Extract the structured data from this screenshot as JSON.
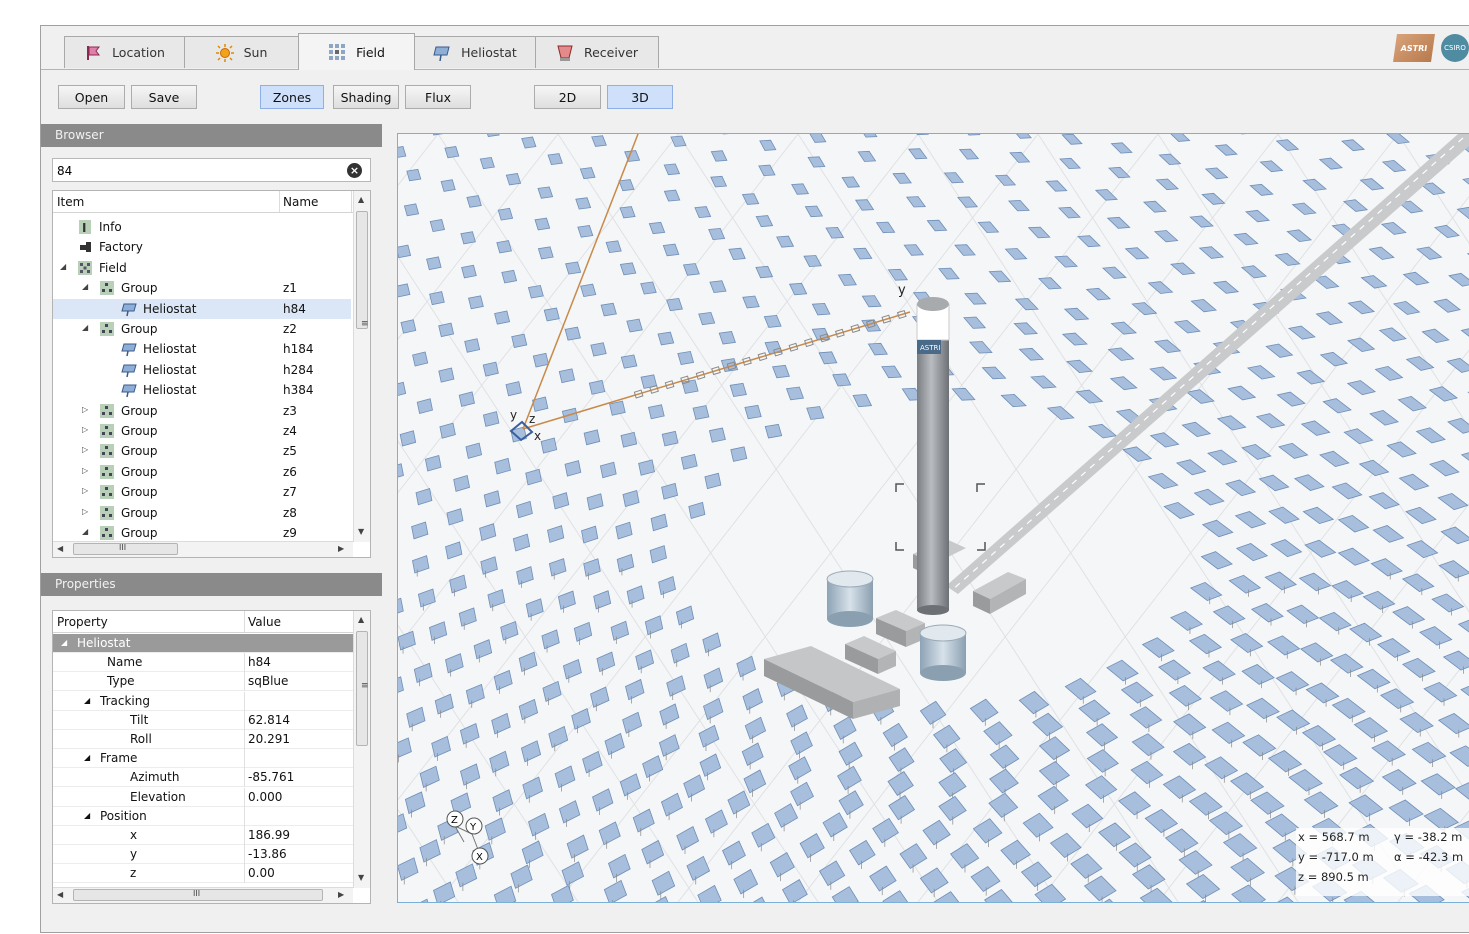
{
  "tabs": [
    {
      "label": "Location",
      "icon": "flag-icon"
    },
    {
      "label": "Sun",
      "icon": "sun-icon"
    },
    {
      "label": "Field",
      "icon": "field-grid-icon",
      "active": true
    },
    {
      "label": "Heliostat",
      "icon": "heliostat-icon"
    },
    {
      "label": "Receiver",
      "icon": "receiver-icon"
    }
  ],
  "logos": {
    "astri": "ASTRI",
    "csiro": "CSIRO"
  },
  "toolbar": {
    "open": "Open",
    "save": "Save",
    "zones": "Zones",
    "shading": "Shading",
    "flux": "Flux",
    "view2d": "2D",
    "view3d": "3D"
  },
  "browser": {
    "title": "Browser",
    "search_value": "84",
    "col_item": "Item",
    "col_name": "Name",
    "rows": [
      {
        "label": "Info",
        "name": "",
        "icon": "info-icon"
      },
      {
        "label": "Factory",
        "name": "",
        "icon": "factory-icon"
      },
      {
        "label": "Field",
        "name": "",
        "icon": "field-icon"
      },
      {
        "label": "Group",
        "name": "z1",
        "icon": "group-icon"
      },
      {
        "label": "Heliostat",
        "name": "h84",
        "icon": "heliostat-icon",
        "selected": true
      },
      {
        "label": "Group",
        "name": "z2",
        "icon": "group-icon"
      },
      {
        "label": "Heliostat",
        "name": "h184",
        "icon": "heliostat-icon"
      },
      {
        "label": "Heliostat",
        "name": "h284",
        "icon": "heliostat-icon"
      },
      {
        "label": "Heliostat",
        "name": "h384",
        "icon": "heliostat-icon"
      },
      {
        "label": "Group",
        "name": "z3",
        "icon": "group-icon"
      },
      {
        "label": "Group",
        "name": "z4",
        "icon": "group-icon"
      },
      {
        "label": "Group",
        "name": "z5",
        "icon": "group-icon"
      },
      {
        "label": "Group",
        "name": "z6",
        "icon": "group-icon"
      },
      {
        "label": "Group",
        "name": "z7",
        "icon": "group-icon"
      },
      {
        "label": "Group",
        "name": "z8",
        "icon": "group-icon"
      },
      {
        "label": "Group",
        "name": "z9",
        "icon": "group-icon"
      }
    ]
  },
  "properties": {
    "title": "Properties",
    "col_property": "Property",
    "col_value": "Value",
    "rows": [
      {
        "key": "Heliostat",
        "value": ""
      },
      {
        "key": "Name",
        "value": "h84"
      },
      {
        "key": "Type",
        "value": "sqBlue"
      },
      {
        "key": "Tracking",
        "value": ""
      },
      {
        "key": "Tilt",
        "value": "62.814"
      },
      {
        "key": "Roll",
        "value": "20.291"
      },
      {
        "key": "Frame",
        "value": ""
      },
      {
        "key": "Azimuth",
        "value": "-85.761"
      },
      {
        "key": "Elevation",
        "value": "0.000"
      },
      {
        "key": "Position",
        "value": ""
      },
      {
        "key": "x",
        "value": "186.99"
      },
      {
        "key": "y",
        "value": "-13.86"
      },
      {
        "key": "z",
        "value": "0.00"
      }
    ]
  },
  "viewport": {
    "tower_label": "ASTRI",
    "axis_labels": {
      "y_tower": "y",
      "y_helio": "y",
      "z_helio": "z",
      "x_helio": "x"
    },
    "gizmo": {
      "z": "Z",
      "y": "Y",
      "x": "X"
    },
    "coords": {
      "x": "x = 568.7 m",
      "y": "y = -717.0 m",
      "z": "z = 890.5 m",
      "gamma": "γ = -38.2 m",
      "alpha": "α = -42.3 m"
    }
  }
}
